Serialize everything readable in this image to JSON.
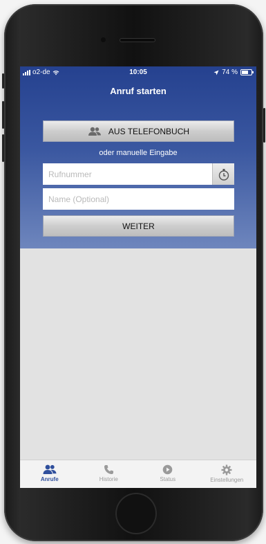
{
  "status_bar": {
    "carrier": "o2-de",
    "time": "10:05",
    "battery": "74 %"
  },
  "header": {
    "title": "Anruf starten"
  },
  "phonebook_button": {
    "label": "AUS TELEFONBUCH"
  },
  "manual_hint": "oder manuelle Eingabe",
  "number_field": {
    "placeholder": "Rufnummer",
    "value": ""
  },
  "name_field": {
    "placeholder": "Name (Optional)",
    "value": ""
  },
  "next_button": {
    "label": "WEITER"
  },
  "tabs": [
    {
      "label": "Anrufe",
      "icon": "people-icon",
      "active": true
    },
    {
      "label": "Historie",
      "icon": "phone-handset-icon",
      "active": false
    },
    {
      "label": "Status",
      "icon": "play-circle-icon",
      "active": false
    },
    {
      "label": "Einstellungen",
      "icon": "gear-icon",
      "active": false
    }
  ],
  "colors": {
    "header_top": "#25418f",
    "header_bottom": "#6e86bd",
    "active_tab": "#2f4f9c",
    "content_bg": "#e2e2e2"
  }
}
